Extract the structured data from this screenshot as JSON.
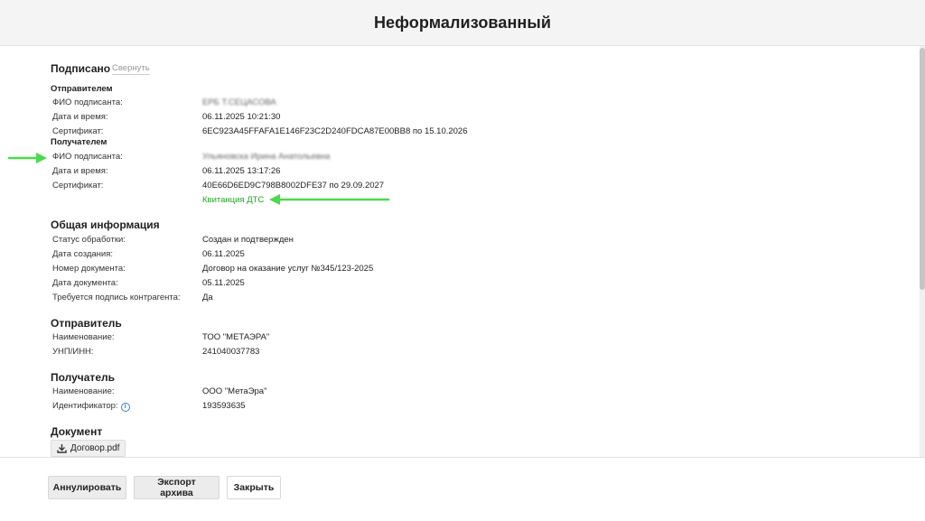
{
  "header": {
    "title": "Неформализованный"
  },
  "signed": {
    "title": "Подписано",
    "collapse_label": "Свернуть",
    "sender": {
      "title": "Отправителем",
      "name_label": "ФИО подписанта:",
      "name_value": "ЕРБ Т.СЕЦАСОВА",
      "datetime_label": "Дата и время:",
      "datetime_value": "06.11.2025 10:21:30",
      "cert_label": "Сертификат:",
      "cert_value": "6EC923A45FFAFA1E146F23C2D240FDCA87E00BB8 по 15.10.2026"
    },
    "receiver": {
      "title": "Получателем",
      "name_label": "ФИО подписанта:",
      "name_value": "Ульяновска Ирина Анатольевна",
      "datetime_label": "Дата и время:",
      "datetime_value": "06.11.2025 13:17:26",
      "cert_label": "Сертификат:",
      "cert_value": "40E66D6ED9C798B8002DFE37 по 29.09.2027",
      "receipt_link": "Квитанция ДТС"
    }
  },
  "general": {
    "title": "Общая информация",
    "rows": [
      {
        "label": "Статус обработки:",
        "value": "Создан и подтвержден"
      },
      {
        "label": "Дата создания:",
        "value": "06.11.2025"
      },
      {
        "label": "Номер документа:",
        "value": "Договор на оказание услуг №345/123-2025"
      },
      {
        "label": "Дата документа:",
        "value": "05.11.2025"
      },
      {
        "label": "Требуется подпись контрагента:",
        "value": "Да"
      }
    ]
  },
  "sender_info": {
    "title": "Отправитель",
    "rows": [
      {
        "label": "Наименование:",
        "value": "ТОО \"МЕТАЭРА\""
      },
      {
        "label": "УНП/ИНН:",
        "value": "241040037783"
      }
    ]
  },
  "receiver_info": {
    "title": "Получатель",
    "rows": [
      {
        "label": "Наименование:",
        "value": "ООО \"МетаЭра\""
      },
      {
        "label": "Идентификатор:",
        "value": "193593635"
      }
    ],
    "info_icon": "info-icon"
  },
  "document": {
    "title": "Документ",
    "file_name": "Договор.pdf",
    "file_icon": "download-icon"
  },
  "footer": {
    "annul_label": "Аннулировать",
    "export_label": "Экспорт архива",
    "close_label": "Закрыть"
  },
  "colors": {
    "accent_green": "#1ea81e",
    "arrow_green": "#4cd94c",
    "header_bg": "#f4f4f4",
    "info_blue": "#2a86d6"
  }
}
